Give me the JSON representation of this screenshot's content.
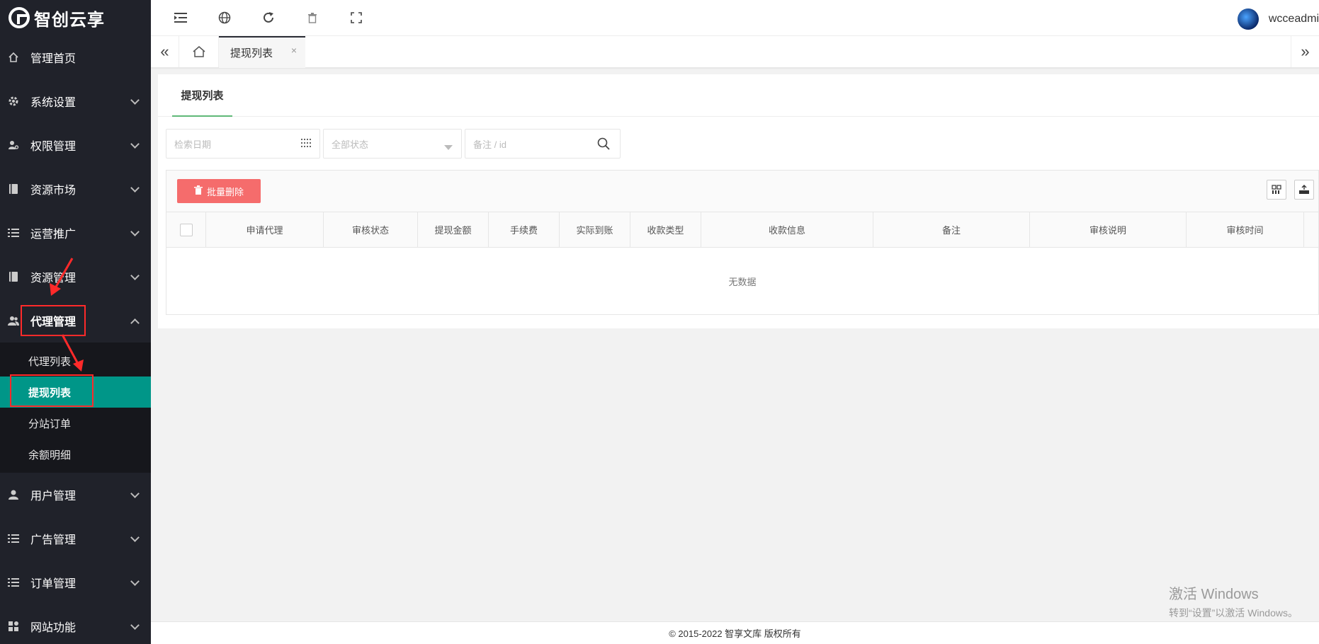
{
  "brand": {
    "name": "智创云享"
  },
  "sidebar": {
    "items": [
      {
        "label": "管理首页",
        "icon": "home-icon"
      },
      {
        "label": "系统设置",
        "icon": "gear-icon"
      },
      {
        "label": "权限管理",
        "icon": "key-user-icon"
      },
      {
        "label": "资源市场",
        "icon": "book-icon"
      },
      {
        "label": "运营推广",
        "icon": "list-icon"
      },
      {
        "label": "资源管理",
        "icon": "book-icon"
      },
      {
        "label": "代理管理",
        "icon": "users-icon"
      }
    ],
    "sub_items": [
      {
        "label": "代理列表"
      },
      {
        "label": "提现列表"
      },
      {
        "label": "分站订单"
      },
      {
        "label": "余额明细"
      }
    ],
    "items_after": [
      {
        "label": "用户管理",
        "icon": "user-icon"
      },
      {
        "label": "广告管理",
        "icon": "list-icon"
      },
      {
        "label": "订单管理",
        "icon": "list-icon"
      },
      {
        "label": "网站功能",
        "icon": "apps-icon"
      }
    ]
  },
  "header": {
    "username": "wcceadmi"
  },
  "tabs": {
    "active_label": "提现列表",
    "close_glyph": "×"
  },
  "panel": {
    "tab_label": "提现列表",
    "filters": {
      "date_placeholder": "检索日期",
      "status_value": "全部状态",
      "search_placeholder": "备注 / id"
    },
    "toolbar": {
      "batch_delete_label": "批量删除"
    },
    "columns": [
      "申请代理",
      "审核状态",
      "提现金额",
      "手续费",
      "实际到账",
      "收款类型",
      "收款信息",
      "备注",
      "审核说明",
      "审核时间"
    ],
    "empty_text": "无数据"
  },
  "footer": {
    "copyright": "© 2015-2022 智享文库 版权所有"
  },
  "watermark": {
    "line1": "激活 Windows",
    "line2": "转到“设置”以激活 Windows。"
  },
  "colors": {
    "sidebar_bg": "#20222a",
    "active_green": "#009688",
    "danger": "#f56c6c",
    "highlight_red": "#ff2a2a"
  }
}
